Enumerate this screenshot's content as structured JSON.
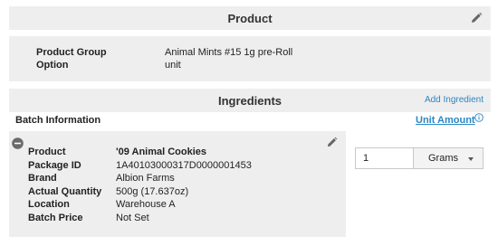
{
  "product_section": {
    "title": "Product",
    "rows": [
      {
        "label": "Product Group",
        "value": "Animal Mints #15 1g pre-Roll"
      },
      {
        "label": "Option",
        "value": "unit"
      }
    ]
  },
  "ingredients_section": {
    "title": "Ingredients",
    "add_label": "Add Ingredient",
    "batch_info_label": "Batch Information",
    "unit_amount_label": "Unit Amount",
    "batch": {
      "rows": [
        {
          "label": "Product",
          "value": "'09 Animal Cookies"
        },
        {
          "label": "Package ID",
          "value": "1A40103000317D0000001453"
        },
        {
          "label": "Brand",
          "value": "Albion Farms"
        },
        {
          "label": "Actual Quantity",
          "value": "500g (17.637oz)"
        },
        {
          "label": "Location",
          "value": "Warehouse A"
        },
        {
          "label": "Batch Price",
          "value": "Not Set"
        }
      ],
      "quantity": "1",
      "unit": "Grams"
    }
  },
  "icons": [
    "pencil-icon",
    "minus-circle-icon",
    "info-icon",
    "caret-down-icon"
  ],
  "colors": {
    "link": "#2b86c5",
    "panel": "#eeeeee"
  }
}
